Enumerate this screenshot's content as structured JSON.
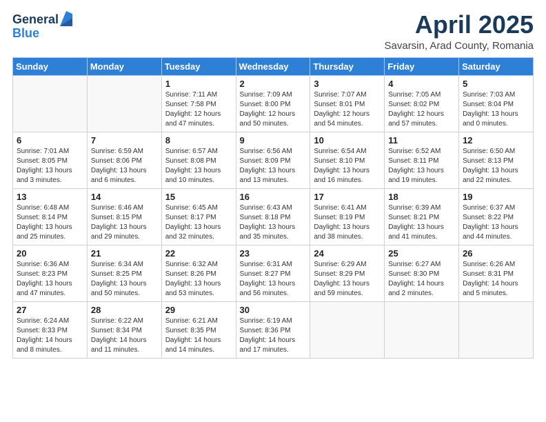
{
  "header": {
    "logo_general": "General",
    "logo_blue": "Blue",
    "title": "April 2025",
    "subtitle": "Savarsin, Arad County, Romania"
  },
  "days_of_week": [
    "Sunday",
    "Monday",
    "Tuesday",
    "Wednesday",
    "Thursday",
    "Friday",
    "Saturday"
  ],
  "weeks": [
    [
      {
        "day": "",
        "detail": ""
      },
      {
        "day": "",
        "detail": ""
      },
      {
        "day": "1",
        "detail": "Sunrise: 7:11 AM\nSunset: 7:58 PM\nDaylight: 12 hours and 47 minutes."
      },
      {
        "day": "2",
        "detail": "Sunrise: 7:09 AM\nSunset: 8:00 PM\nDaylight: 12 hours and 50 minutes."
      },
      {
        "day": "3",
        "detail": "Sunrise: 7:07 AM\nSunset: 8:01 PM\nDaylight: 12 hours and 54 minutes."
      },
      {
        "day": "4",
        "detail": "Sunrise: 7:05 AM\nSunset: 8:02 PM\nDaylight: 12 hours and 57 minutes."
      },
      {
        "day": "5",
        "detail": "Sunrise: 7:03 AM\nSunset: 8:04 PM\nDaylight: 13 hours and 0 minutes."
      }
    ],
    [
      {
        "day": "6",
        "detail": "Sunrise: 7:01 AM\nSunset: 8:05 PM\nDaylight: 13 hours and 3 minutes."
      },
      {
        "day": "7",
        "detail": "Sunrise: 6:59 AM\nSunset: 8:06 PM\nDaylight: 13 hours and 6 minutes."
      },
      {
        "day": "8",
        "detail": "Sunrise: 6:57 AM\nSunset: 8:08 PM\nDaylight: 13 hours and 10 minutes."
      },
      {
        "day": "9",
        "detail": "Sunrise: 6:56 AM\nSunset: 8:09 PM\nDaylight: 13 hours and 13 minutes."
      },
      {
        "day": "10",
        "detail": "Sunrise: 6:54 AM\nSunset: 8:10 PM\nDaylight: 13 hours and 16 minutes."
      },
      {
        "day": "11",
        "detail": "Sunrise: 6:52 AM\nSunset: 8:11 PM\nDaylight: 13 hours and 19 minutes."
      },
      {
        "day": "12",
        "detail": "Sunrise: 6:50 AM\nSunset: 8:13 PM\nDaylight: 13 hours and 22 minutes."
      }
    ],
    [
      {
        "day": "13",
        "detail": "Sunrise: 6:48 AM\nSunset: 8:14 PM\nDaylight: 13 hours and 25 minutes."
      },
      {
        "day": "14",
        "detail": "Sunrise: 6:46 AM\nSunset: 8:15 PM\nDaylight: 13 hours and 29 minutes."
      },
      {
        "day": "15",
        "detail": "Sunrise: 6:45 AM\nSunset: 8:17 PM\nDaylight: 13 hours and 32 minutes."
      },
      {
        "day": "16",
        "detail": "Sunrise: 6:43 AM\nSunset: 8:18 PM\nDaylight: 13 hours and 35 minutes."
      },
      {
        "day": "17",
        "detail": "Sunrise: 6:41 AM\nSunset: 8:19 PM\nDaylight: 13 hours and 38 minutes."
      },
      {
        "day": "18",
        "detail": "Sunrise: 6:39 AM\nSunset: 8:21 PM\nDaylight: 13 hours and 41 minutes."
      },
      {
        "day": "19",
        "detail": "Sunrise: 6:37 AM\nSunset: 8:22 PM\nDaylight: 13 hours and 44 minutes."
      }
    ],
    [
      {
        "day": "20",
        "detail": "Sunrise: 6:36 AM\nSunset: 8:23 PM\nDaylight: 13 hours and 47 minutes."
      },
      {
        "day": "21",
        "detail": "Sunrise: 6:34 AM\nSunset: 8:25 PM\nDaylight: 13 hours and 50 minutes."
      },
      {
        "day": "22",
        "detail": "Sunrise: 6:32 AM\nSunset: 8:26 PM\nDaylight: 13 hours and 53 minutes."
      },
      {
        "day": "23",
        "detail": "Sunrise: 6:31 AM\nSunset: 8:27 PM\nDaylight: 13 hours and 56 minutes."
      },
      {
        "day": "24",
        "detail": "Sunrise: 6:29 AM\nSunset: 8:29 PM\nDaylight: 13 hours and 59 minutes."
      },
      {
        "day": "25",
        "detail": "Sunrise: 6:27 AM\nSunset: 8:30 PM\nDaylight: 14 hours and 2 minutes."
      },
      {
        "day": "26",
        "detail": "Sunrise: 6:26 AM\nSunset: 8:31 PM\nDaylight: 14 hours and 5 minutes."
      }
    ],
    [
      {
        "day": "27",
        "detail": "Sunrise: 6:24 AM\nSunset: 8:33 PM\nDaylight: 14 hours and 8 minutes."
      },
      {
        "day": "28",
        "detail": "Sunrise: 6:22 AM\nSunset: 8:34 PM\nDaylight: 14 hours and 11 minutes."
      },
      {
        "day": "29",
        "detail": "Sunrise: 6:21 AM\nSunset: 8:35 PM\nDaylight: 14 hours and 14 minutes."
      },
      {
        "day": "30",
        "detail": "Sunrise: 6:19 AM\nSunset: 8:36 PM\nDaylight: 14 hours and 17 minutes."
      },
      {
        "day": "",
        "detail": ""
      },
      {
        "day": "",
        "detail": ""
      },
      {
        "day": "",
        "detail": ""
      }
    ]
  ]
}
